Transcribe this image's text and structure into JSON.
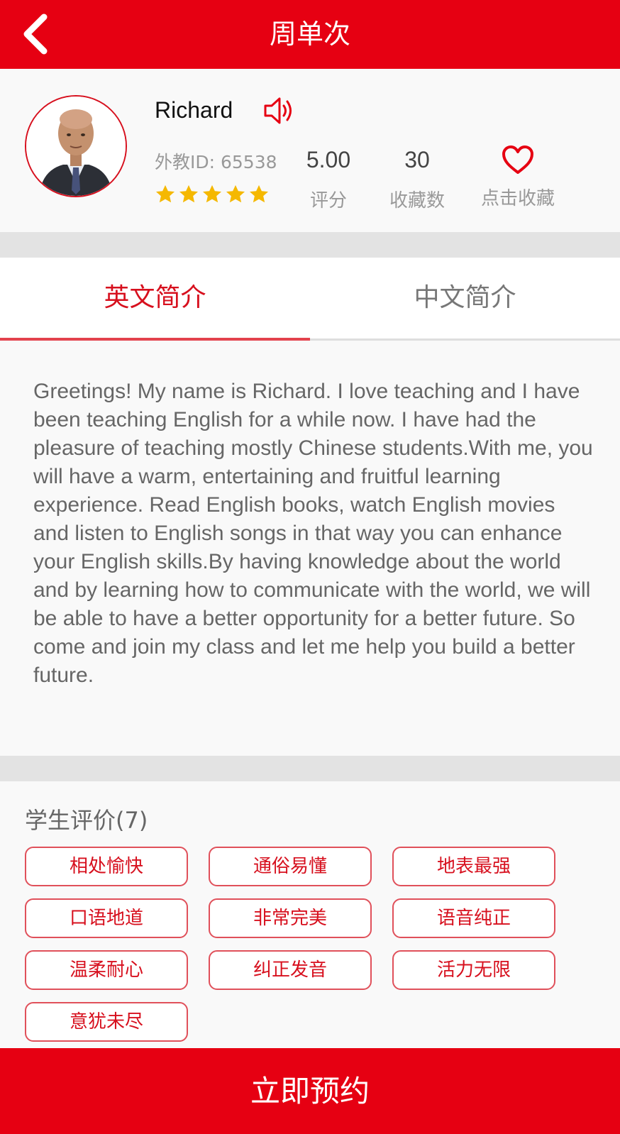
{
  "header": {
    "title": "周单次",
    "back_icon": "chevron-left-icon"
  },
  "teacher": {
    "name": "Richard",
    "id_text": "外教ID: 65538",
    "rating_stars": 5,
    "score_value": "5.00",
    "score_label": "评分",
    "favorites_value": "30",
    "favorites_label": "收藏数",
    "favorite_action": "点击收藏"
  },
  "tabs": [
    {
      "label": "英文简介",
      "active": true
    },
    {
      "label": "中文简介",
      "active": false
    }
  ],
  "intro": {
    "text": "Greetings! My name is Richard. I love teaching and I have been teaching English for a while now. I have had the pleasure of teaching mostly Chinese students.With me, you will have a warm, entertaining and fruitful learning experience. Read English books, watch English movies and listen to English songs in that way you can enhance your English skills.By having knowledge about the world and by learning how to communicate with the world, we will be able to have a better opportunity for a better future. So come and join my class and let me help you build a better future."
  },
  "reviews": {
    "title": "学生评价(7)",
    "tags": [
      "相处愉快",
      "通俗易懂",
      "地表最强",
      "口语地道",
      "非常完美",
      "语音纯正",
      "温柔耐心",
      "纠正发音",
      "活力无限",
      "意犹未尽"
    ]
  },
  "footer": {
    "book_label": "立即预约"
  },
  "colors": {
    "primary_red": "#e60012",
    "star_gold": "#f5b800",
    "divider_gray": "#e3e3e3"
  }
}
